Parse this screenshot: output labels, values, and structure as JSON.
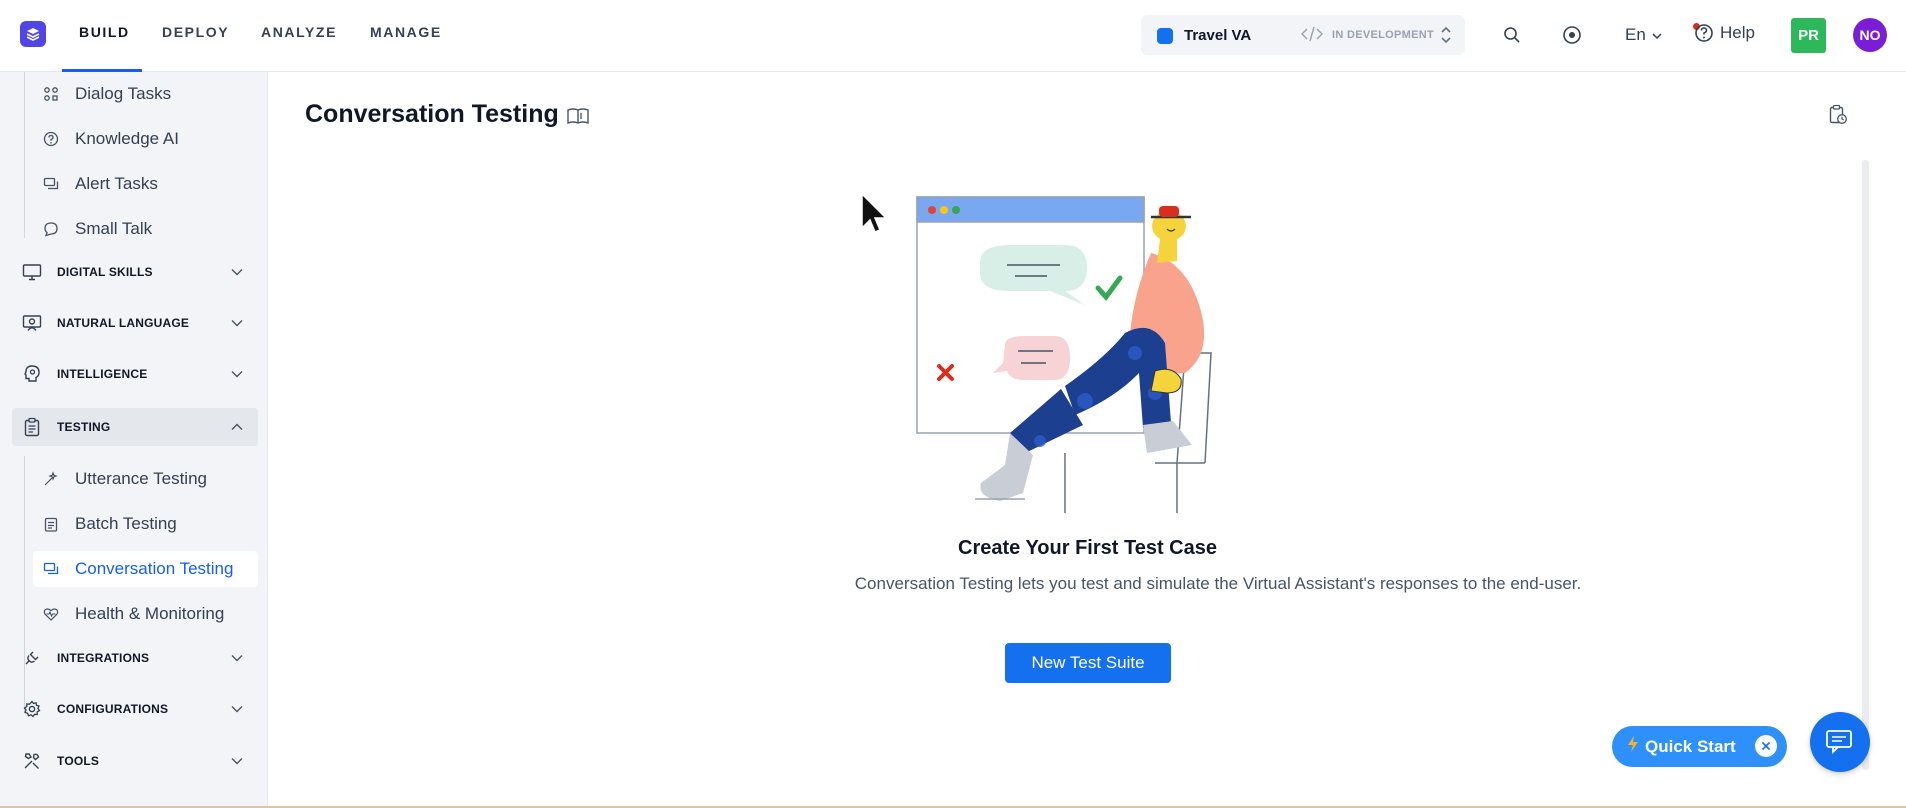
{
  "topbar": {
    "tabs": [
      {
        "label": "BUILD",
        "active": true
      },
      {
        "label": "DEPLOY",
        "active": false
      },
      {
        "label": "ANALYZE",
        "active": false
      },
      {
        "label": "MANAGE",
        "active": false
      }
    ],
    "bot": {
      "name": "Travel VA",
      "status": "IN DEVELOPMENT"
    },
    "language": "En",
    "help_label": "Help",
    "user_initials": "PR",
    "account_initials": "NO",
    "colors": {
      "accent": "#155eef",
      "user_badge": "#2eb85c",
      "account_badge": "#7a1ed6"
    }
  },
  "sidebar": {
    "top_items": [
      {
        "label": "Dialog Tasks",
        "icon": "dialog-tasks-icon"
      },
      {
        "label": "Knowledge AI",
        "icon": "knowledge-ai-icon"
      },
      {
        "label": "Alert Tasks",
        "icon": "alert-tasks-icon"
      },
      {
        "label": "Small Talk",
        "icon": "small-talk-icon"
      }
    ],
    "sections": [
      {
        "label": "DIGITAL SKILLS",
        "icon": "monitor-icon",
        "expanded": false
      },
      {
        "label": "NATURAL LANGUAGE",
        "icon": "natural-language-icon",
        "expanded": false
      },
      {
        "label": "INTELLIGENCE",
        "icon": "intelligence-icon",
        "expanded": false
      },
      {
        "label": "TESTING",
        "icon": "clipboard-icon",
        "expanded": true
      },
      {
        "label": "INTEGRATIONS",
        "icon": "plug-icon",
        "expanded": false
      },
      {
        "label": "CONFIGURATIONS",
        "icon": "settings-icon",
        "expanded": false
      },
      {
        "label": "TOOLS",
        "icon": "tools-icon",
        "expanded": false
      }
    ],
    "testing_items": [
      {
        "label": "Utterance Testing",
        "icon": "utterance-testing-icon",
        "active": false
      },
      {
        "label": "Batch Testing",
        "icon": "batch-testing-icon",
        "active": false
      },
      {
        "label": "Conversation Testing",
        "icon": "conversation-testing-icon",
        "active": true
      },
      {
        "label": "Health & Monitoring",
        "icon": "heart-monitor-icon",
        "active": false
      }
    ]
  },
  "main": {
    "title": "Conversation Testing",
    "empty_state": {
      "title": "Create Your First Test Case",
      "description": "Conversation Testing lets you test and simulate the Virtual Assistant's responses to the end-user.",
      "button_label": "New Test Suite"
    }
  },
  "floating": {
    "quick_start_label": "Quick Start"
  }
}
